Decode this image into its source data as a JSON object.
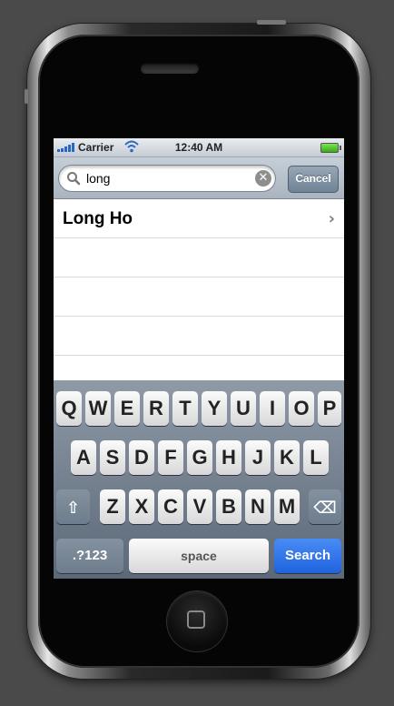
{
  "status": {
    "carrier": "Carrier",
    "time": "12:40 AM"
  },
  "search": {
    "value": "long",
    "cancel": "Cancel"
  },
  "results": [
    {
      "label": "Long Ho"
    }
  ],
  "keyboard": {
    "row1": [
      "Q",
      "W",
      "E",
      "R",
      "T",
      "Y",
      "U",
      "I",
      "O",
      "P"
    ],
    "row2": [
      "A",
      "S",
      "D",
      "F",
      "G",
      "H",
      "J",
      "K",
      "L"
    ],
    "row3": [
      "Z",
      "X",
      "C",
      "V",
      "B",
      "N",
      "M"
    ],
    "numbers": ".?123",
    "space": "space",
    "search": "Search"
  },
  "icons": {
    "shift": "shift-icon",
    "delete": "backspace-icon",
    "search": "search-icon",
    "clear": "clear-icon"
  },
  "colors": {
    "search_key": "#1f63df",
    "cancel": "#6f8396"
  }
}
